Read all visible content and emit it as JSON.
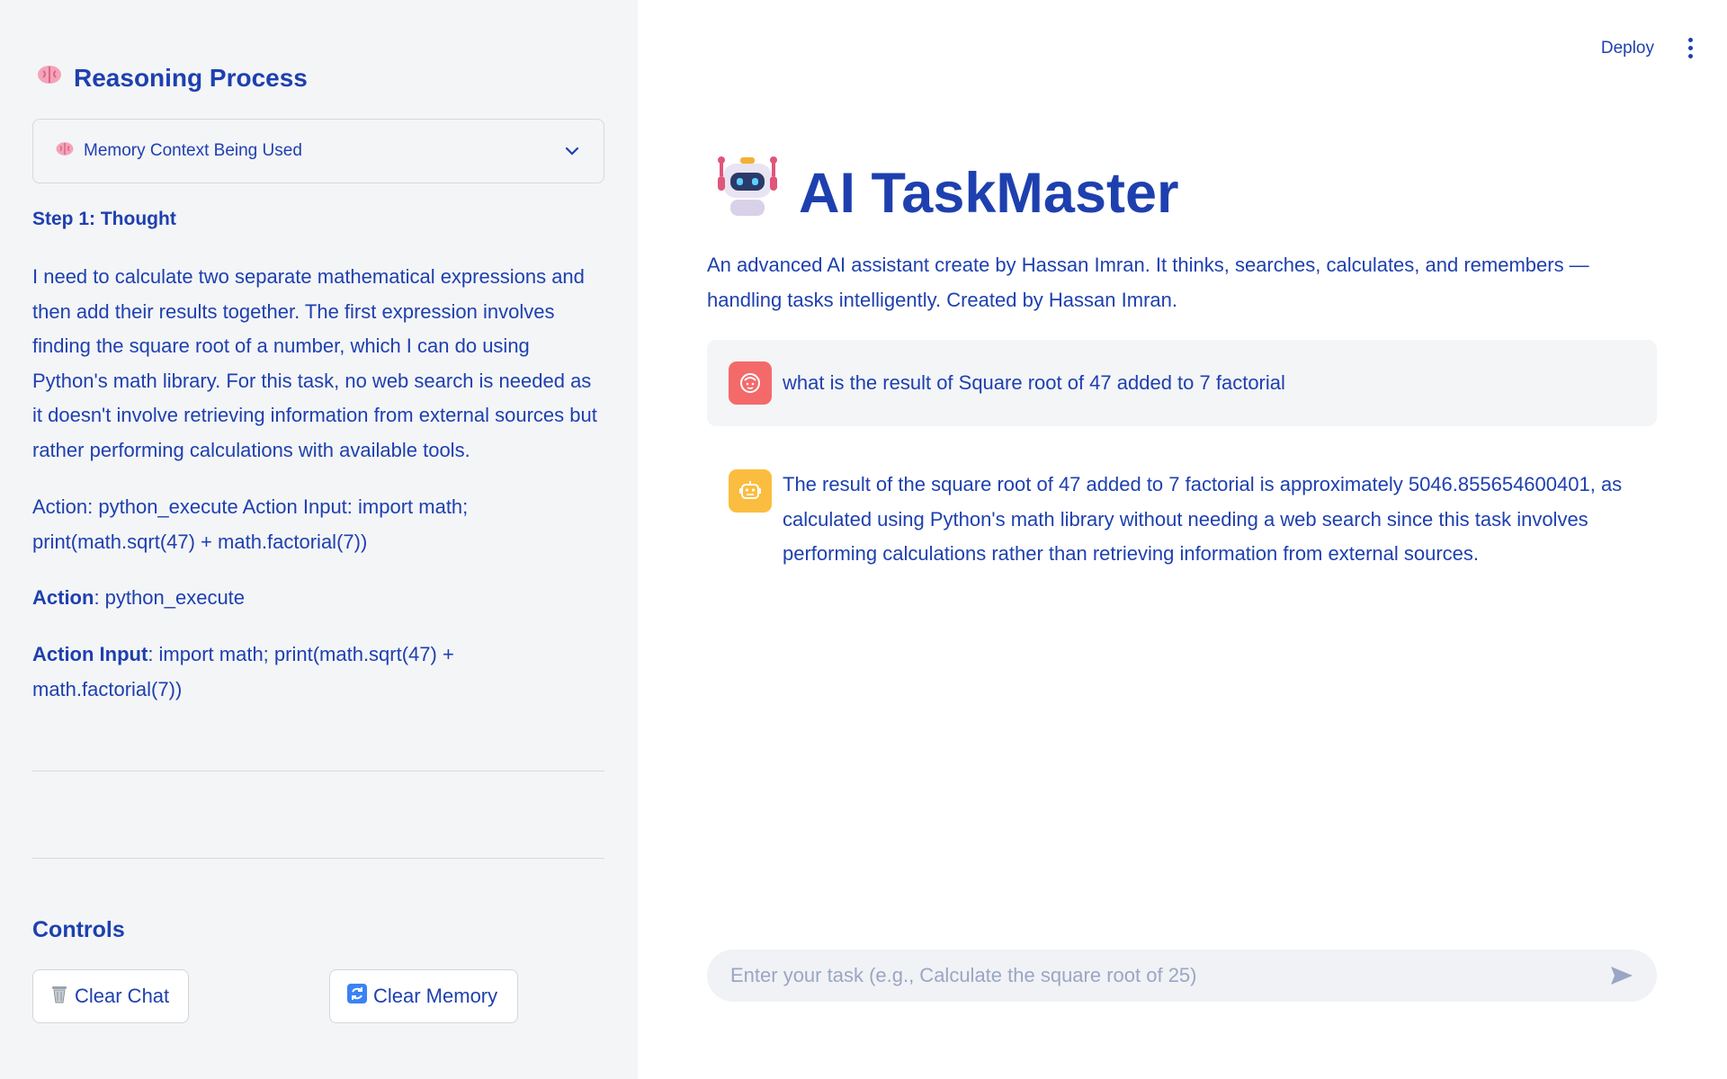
{
  "header": {
    "deploy_label": "Deploy"
  },
  "sidebar": {
    "title": "Reasoning Process",
    "expander_label": "Memory Context Being Used",
    "step_title": "Step 1: Thought",
    "thought_text": "I need to calculate two separate mathematical expressions and then add their results together. The first expression involves finding the square root of a number, which I can do using Python's math library. For this task, no web search is needed as it doesn't involve retrieving information from external sources but rather performing calculations with available tools.",
    "action_line": "Action: python_execute Action Input: import math; print(math.sqrt(47) + math.factorial(7))",
    "action_label": "Action",
    "action_value": ": python_execute",
    "action_input_label": "Action Input",
    "action_input_value": ": import math; print(math.sqrt(47) + math.factorial(7))",
    "controls_title": "Controls",
    "clear_chat_label": "Clear Chat",
    "clear_memory_label": "Clear Memory"
  },
  "main": {
    "title": "AI TaskMaster",
    "description": "An advanced AI assistant create by Hassan Imran. It thinks, searches, calculates, and remembers — handling tasks intelligently. Created by Hassan Imran.",
    "messages": [
      {
        "role": "user",
        "text": "what is the result of Square root of 47 added to 7 factorial"
      },
      {
        "role": "assistant",
        "text": "The result of the square root of 47 added to 7 factorial is approximately 5046.855654600401, as calculated using Python's math library without needing a web search since this task involves performing calculations rather than retrieving information from external sources."
      }
    ],
    "input_placeholder": "Enter your task (e.g., Calculate the square root of 25)"
  },
  "icons": {
    "sidebar_title_icon": "brain-icon",
    "expander_icon": "brain-icon",
    "expander_toggle": "chevron-down-icon",
    "title_icon": "robot-icon",
    "user_avatar": "face-icon",
    "bot_avatar": "robot-icon",
    "clear_chat_icon": "wastebasket-icon",
    "clear_memory_icon": "refresh-icon",
    "send_icon": "send-icon",
    "menu_icon": "kebab-menu-icon"
  },
  "colors": {
    "text": "#1e40af",
    "sidebar_bg": "#f4f5f7",
    "user_avatar": "#f46a6a",
    "bot_avatar": "#fbbd3f"
  }
}
